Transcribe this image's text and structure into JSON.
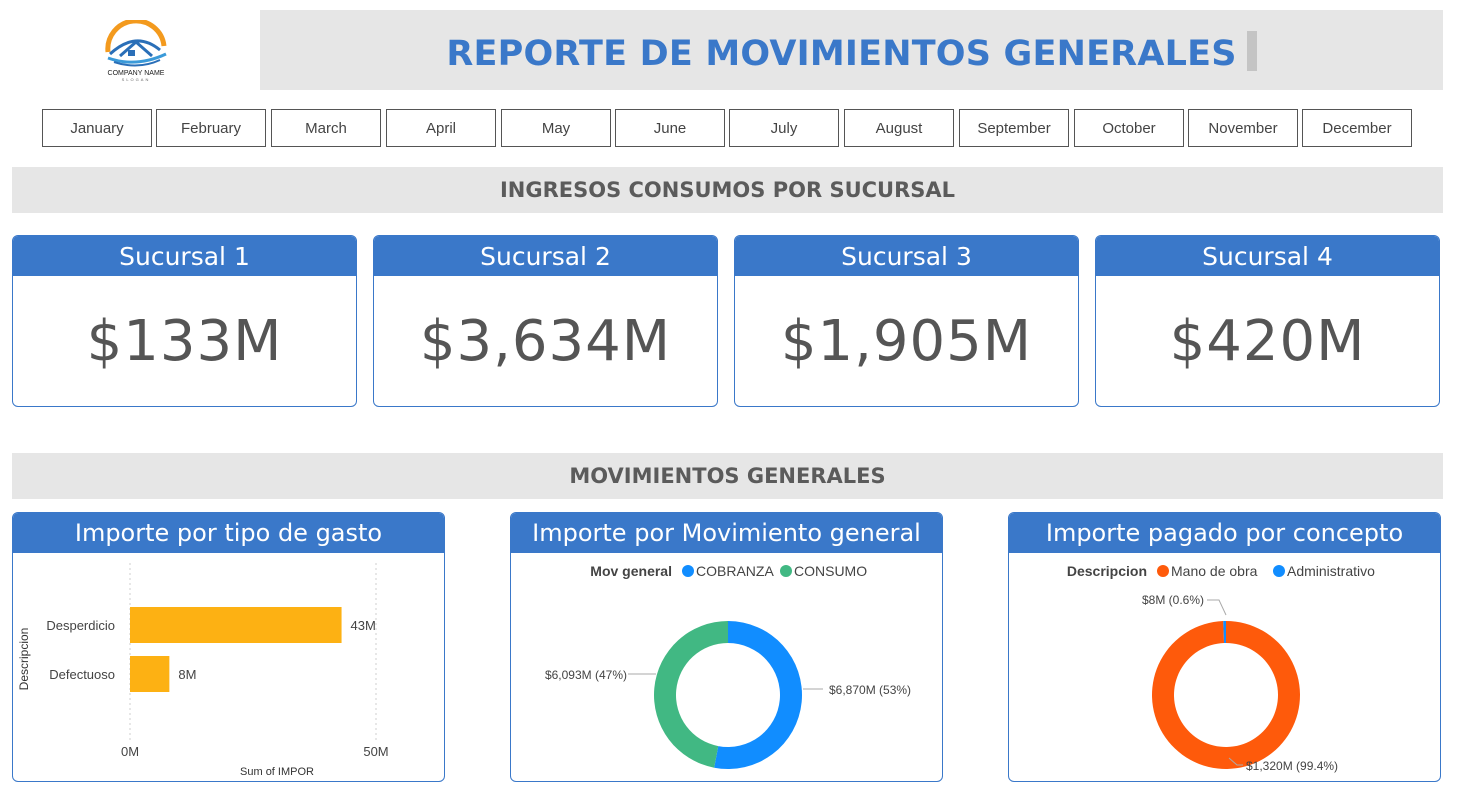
{
  "header": {
    "title": "REPORTE DE MOVIMIENTOS GENERALES",
    "logo_name": "COMPANY NAME",
    "logo_slogan": "SLOGAN"
  },
  "months": [
    "January",
    "February",
    "March",
    "April",
    "May",
    "June",
    "July",
    "August",
    "September",
    "October",
    "November",
    "December"
  ],
  "sections": {
    "ingresos": "INGRESOS CONSUMOS POR SUCURSAL",
    "movimientos": "MOVIMIENTOS GENERALES"
  },
  "kpis": [
    {
      "title": "Sucursal 1",
      "value": "$133M"
    },
    {
      "title": "Sucursal 2",
      "value": "$3,634M"
    },
    {
      "title": "Sucursal 3",
      "value": "$1,905M"
    },
    {
      "title": "Sucursal 4",
      "value": "$420M"
    }
  ],
  "colors": {
    "accent": "#3a78c9",
    "banner": "#e6e6e6",
    "bar": "#fdb113",
    "cobranza": "#118dff",
    "consumo": "#41b883",
    "mano_de_obra": "#fe5a0b",
    "administrativo": "#118dff"
  },
  "chart_data": [
    {
      "type": "bar",
      "title": "Importe por tipo de gasto",
      "orientation": "horizontal",
      "categories": [
        "Desperdicio",
        "Defectuoso"
      ],
      "values": [
        43,
        8
      ],
      "value_labels": [
        "43M",
        "8M"
      ],
      "xlabel": "Sum of IMPOR",
      "ylabel": "Descripcion",
      "xticks": [
        "0M",
        "50M"
      ],
      "xlim": [
        0,
        50
      ]
    },
    {
      "type": "pie",
      "title": "Importe por Movimiento general",
      "legend_title": "Mov general",
      "legend_position": "top",
      "labels": [
        "COBRANZA",
        "CONSUMO"
      ],
      "values": [
        6870,
        6093
      ],
      "value_labels": [
        "$6,870M (53%)",
        "$6,093M (47%)"
      ]
    },
    {
      "type": "pie",
      "title": "Importe pagado por concepto",
      "legend_title": "Descripcion",
      "legend_position": "top",
      "labels": [
        "Mano de obra",
        "Administrativo"
      ],
      "values": [
        1320,
        8
      ],
      "value_labels": [
        "$1,320M (99.4%)",
        "$8M (0.6%)"
      ]
    }
  ]
}
